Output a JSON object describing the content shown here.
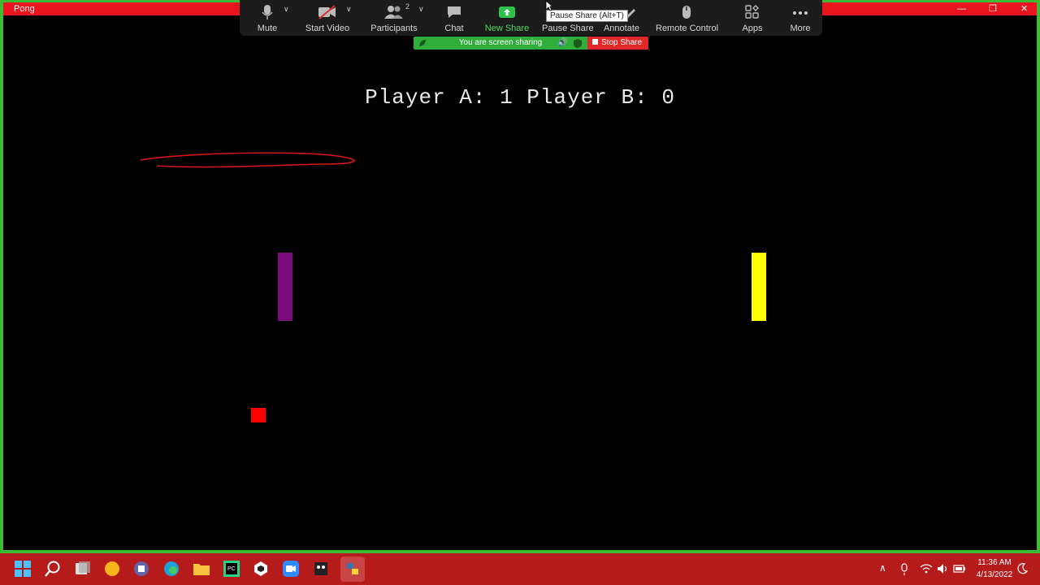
{
  "window": {
    "title": "Pong"
  },
  "game": {
    "score_text": "Player A: 1  Player B: 0",
    "paddle_a_color": "#7d0b7d",
    "paddle_b_color": "#ffff00",
    "ball_color": "#ff0000",
    "annotation_color": "#d4141e"
  },
  "zoom_toolbar": {
    "buttons": [
      {
        "label": "Mute",
        "icon": "microphone-icon"
      },
      {
        "label": "Start Video",
        "icon": "video-off-icon"
      },
      {
        "label": "Participants",
        "icon": "participants-icon",
        "count": "2"
      },
      {
        "label": "Chat",
        "icon": "chat-icon"
      },
      {
        "label": "New Share",
        "icon": "share-up-icon"
      },
      {
        "label": "Pause Share",
        "icon": "pause-icon"
      },
      {
        "label": "Annotate",
        "icon": "pen-icon"
      },
      {
        "label": "Remote Control",
        "icon": "mouse-icon"
      },
      {
        "label": "Apps",
        "icon": "apps-icon"
      },
      {
        "label": "More",
        "icon": "ellipsis-icon"
      }
    ],
    "tooltip": "Pause Share (Alt+T)",
    "share_status": "You are screen sharing",
    "stop_share": "Stop Share"
  },
  "taskbar": {
    "time": "11:36 AM",
    "date": "4/13/2022",
    "icons": [
      "windows-start-icon",
      "search-icon",
      "task-view-icon",
      "chrome-canary-icon",
      "teams-icon",
      "edge-icon",
      "file-explorer-icon",
      "pycharm-icon",
      "unity-icon",
      "zoom-icon",
      "game-icon",
      "python-icon"
    ]
  }
}
